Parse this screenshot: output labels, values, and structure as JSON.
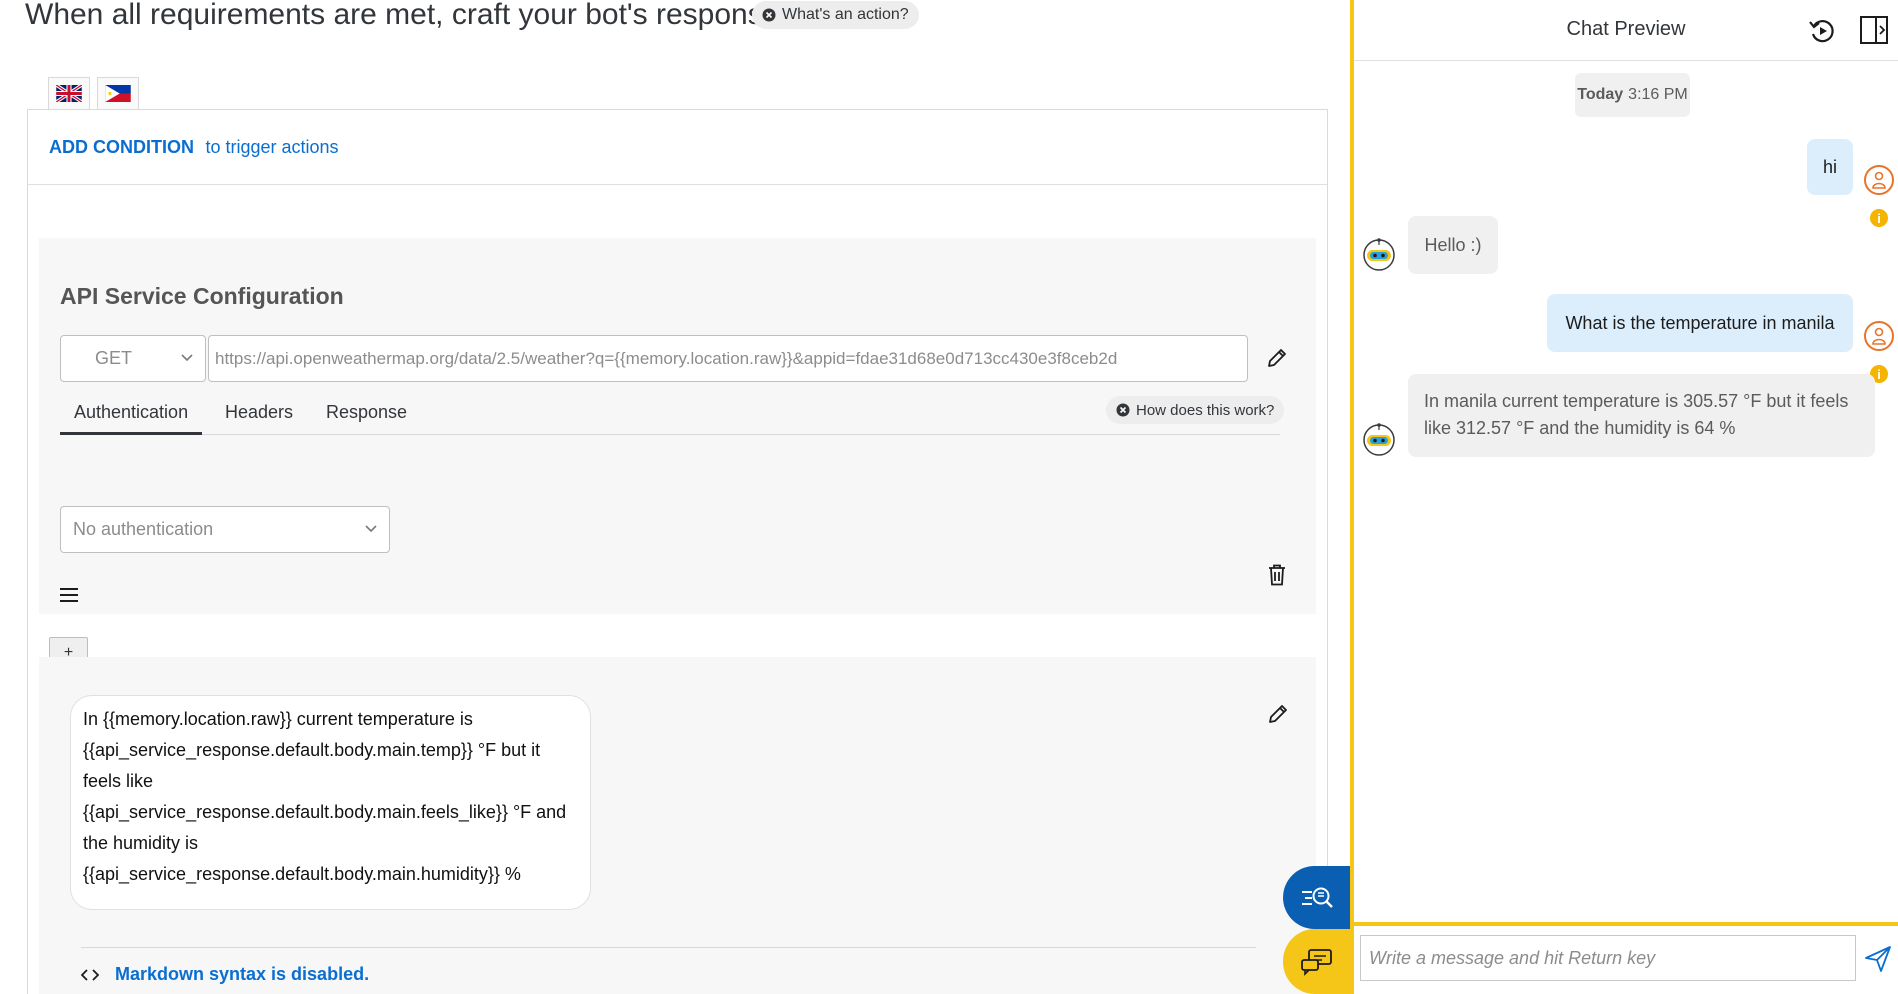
{
  "editor": {
    "title": "When all requirements are met, craft your bot's response",
    "whats_action": "What's an action?",
    "flags": [
      {
        "name": "uk-flag-icon"
      },
      {
        "name": "philippines-flag-icon"
      }
    ],
    "add_condition": "ADD CONDITION",
    "to_trigger": "to trigger actions",
    "api": {
      "heading": "API Service Configuration",
      "method": "GET",
      "url": "https://api.openweathermap.org/data/2.5/weather?q={{memory.location.raw}}&appid=fdae31d68e0d713cc430e3f8ceb2d",
      "tabs": [
        {
          "label": "Authentication",
          "active": true
        },
        {
          "label": "Headers",
          "active": false
        },
        {
          "label": "Response",
          "active": false
        }
      ],
      "how_works": "How does this work?",
      "auth_select": "No authentication"
    },
    "add_button": "+",
    "message_lines": [
      "In {{memory.location.raw}} current temperature is",
      "{{api_service_response.default.body.main.temp}} °F but it",
      "feels like",
      "{{api_service_response.default.body.main.feels_like}} °F and",
      "the humidity is",
      "{{api_service_response.default.body.main.humidity}} %"
    ],
    "markdown_note": "Markdown syntax is disabled."
  },
  "chat": {
    "title": "Chat Preview",
    "date_label": "Today",
    "time": "3:16 PM",
    "messages": [
      {
        "from": "user",
        "text": "hi"
      },
      {
        "from": "bot",
        "text": "Hello :)"
      },
      {
        "from": "user",
        "text": "What is the temperature in manila"
      },
      {
        "from": "bot",
        "line1": "In manila current temperature is 305.57 °F but it feels",
        "line2": "like 312.57 °F and the humidity is 64 %"
      }
    ],
    "info_glyph": "i",
    "input_placeholder": "Write a message and hit Return key"
  },
  "colors": {
    "accent": "#0a6ed1",
    "yellow": "#f5c518",
    "user_bubble": "#dceefc",
    "fab_blue": "#0a5fb3"
  }
}
